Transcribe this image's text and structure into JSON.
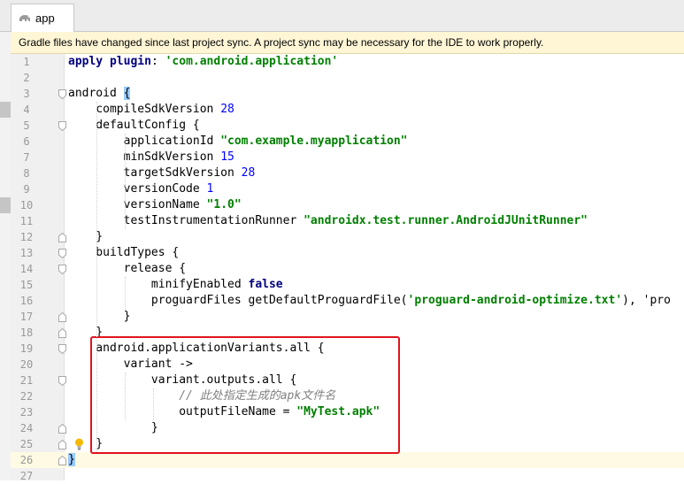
{
  "tab": {
    "label": "app",
    "icon": "gradle-elephant-icon"
  },
  "banner": {
    "message": "Gradle files have changed since last project sync. A project sync may be necessary for the IDE to work properly."
  },
  "editor": {
    "current_line": 26,
    "lines": [
      {
        "n": 1,
        "text": "apply plugin: 'com.android.application'"
      },
      {
        "n": 2,
        "text": ""
      },
      {
        "n": 3,
        "text": "android {"
      },
      {
        "n": 4,
        "text": "    compileSdkVersion 28"
      },
      {
        "n": 5,
        "text": "    defaultConfig {"
      },
      {
        "n": 6,
        "text": "        applicationId \"com.example.myapplication\""
      },
      {
        "n": 7,
        "text": "        minSdkVersion 15"
      },
      {
        "n": 8,
        "text": "        targetSdkVersion 28"
      },
      {
        "n": 9,
        "text": "        versionCode 1"
      },
      {
        "n": 10,
        "text": "        versionName \"1.0\""
      },
      {
        "n": 11,
        "text": "        testInstrumentationRunner \"androidx.test.runner.AndroidJUnitRunner\""
      },
      {
        "n": 12,
        "text": "    }"
      },
      {
        "n": 13,
        "text": "    buildTypes {"
      },
      {
        "n": 14,
        "text": "        release {"
      },
      {
        "n": 15,
        "text": "            minifyEnabled false"
      },
      {
        "n": 16,
        "text": "            proguardFiles getDefaultProguardFile('proguard-android-optimize.txt'), 'pro"
      },
      {
        "n": 17,
        "text": "        }"
      },
      {
        "n": 18,
        "text": "    }"
      },
      {
        "n": 19,
        "text": "    android.applicationVariants.all {"
      },
      {
        "n": 20,
        "text": "        variant ->"
      },
      {
        "n": 21,
        "text": "            variant.outputs.all {"
      },
      {
        "n": 22,
        "text": "                // 此处指定生成的apk文件名"
      },
      {
        "n": 23,
        "text": "                outputFileName = \"MyTest.apk\""
      },
      {
        "n": 24,
        "text": "            }"
      },
      {
        "n": 25,
        "text": "    }"
      },
      {
        "n": 26,
        "text": "}"
      },
      {
        "n": 27,
        "text": ""
      }
    ]
  },
  "colors": {
    "keyword": "#000080",
    "string": "#008000",
    "number": "#0000ff",
    "comment": "#808080",
    "banner_bg": "#fff6d6",
    "highlight_box": "#e0141e"
  },
  "icons": {
    "intention_bulb": "lightbulb-icon",
    "fold_markers": "fold-marker-icon"
  }
}
